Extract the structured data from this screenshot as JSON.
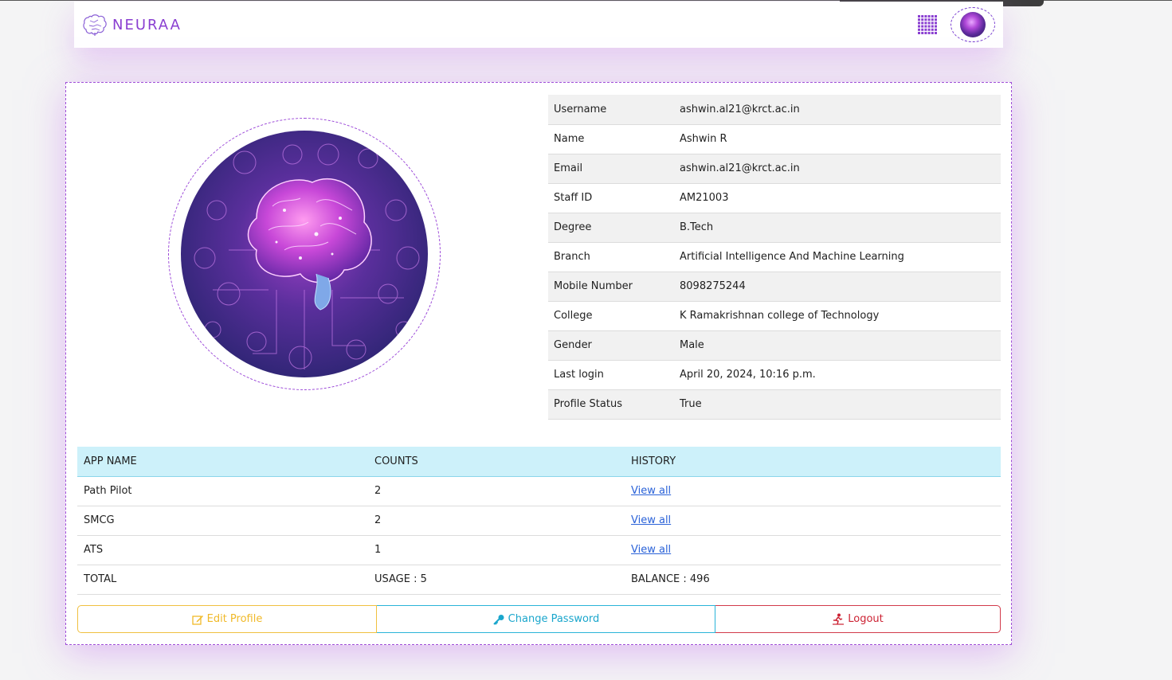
{
  "brand": {
    "name": "NEURAA",
    "logo_icon": "brain-icon",
    "accent": "#8a3fd1"
  },
  "nav": {
    "apps_icon": "grid-apps-icon",
    "avatar_icon": "avatar"
  },
  "profile": {
    "image": "brain-circuit-illustration",
    "fields": [
      {
        "label": "Username",
        "value": "ashwin.al21@krct.ac.in"
      },
      {
        "label": "Name",
        "value": "Ashwin R"
      },
      {
        "label": "Email",
        "value": "ashwin.al21@krct.ac.in"
      },
      {
        "label": "Staff ID",
        "value": "AM21003"
      },
      {
        "label": "Degree",
        "value": "B.Tech"
      },
      {
        "label": "Branch",
        "value": "Artificial Intelligence And Machine Learning"
      },
      {
        "label": "Mobile Number",
        "value": "8098275244"
      },
      {
        "label": "College",
        "value": "K Ramakrishnan college of Technology"
      },
      {
        "label": "Gender",
        "value": "Male"
      },
      {
        "label": "Last login",
        "value": "April 20, 2024, 10:16 p.m."
      },
      {
        "label": "Profile Status",
        "value": "True"
      }
    ]
  },
  "usage": {
    "headers": [
      "APP NAME",
      "COUNTS",
      "HISTORY"
    ],
    "rows": [
      {
        "app": "Path Pilot",
        "count": "2",
        "history": "View all"
      },
      {
        "app": "SMCG",
        "count": "2",
        "history": "View all"
      },
      {
        "app": "ATS",
        "count": "1",
        "history": "View all"
      }
    ],
    "total": {
      "label": "TOTAL",
      "usage": "USAGE : 5",
      "balance": "BALANCE : 496"
    }
  },
  "actions": {
    "edit": {
      "label": "Edit Profile",
      "icon": "edit-icon",
      "color": "#f0b928"
    },
    "password": {
      "label": "Change Password",
      "icon": "key-icon",
      "color": "#1aa6cc"
    },
    "logout": {
      "label": "Logout",
      "icon": "logout-icon",
      "color": "#cc2233"
    }
  }
}
